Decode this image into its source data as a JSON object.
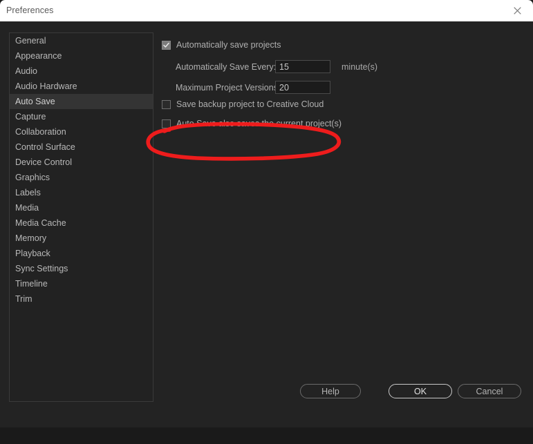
{
  "window": {
    "title": "Preferences",
    "close_icon": "close-icon"
  },
  "sidebar": {
    "items": [
      {
        "label": "General",
        "selected": false
      },
      {
        "label": "Appearance",
        "selected": false
      },
      {
        "label": "Audio",
        "selected": false
      },
      {
        "label": "Audio Hardware",
        "selected": false
      },
      {
        "label": "Auto Save",
        "selected": true
      },
      {
        "label": "Capture",
        "selected": false
      },
      {
        "label": "Collaboration",
        "selected": false
      },
      {
        "label": "Control Surface",
        "selected": false
      },
      {
        "label": "Device Control",
        "selected": false
      },
      {
        "label": "Graphics",
        "selected": false
      },
      {
        "label": "Labels",
        "selected": false
      },
      {
        "label": "Media",
        "selected": false
      },
      {
        "label": "Media Cache",
        "selected": false
      },
      {
        "label": "Memory",
        "selected": false
      },
      {
        "label": "Playback",
        "selected": false
      },
      {
        "label": "Sync Settings",
        "selected": false
      },
      {
        "label": "Timeline",
        "selected": false
      },
      {
        "label": "Trim",
        "selected": false
      }
    ]
  },
  "main": {
    "auto_save_checkbox": {
      "label": "Automatically save projects",
      "checked": true
    },
    "save_every": {
      "label": "Automatically Save Every:",
      "value": "15",
      "unit": "minute(s)"
    },
    "max_versions": {
      "label": "Maximum Project Versions:",
      "value": "20"
    },
    "backup_creative_cloud": {
      "label": "Save backup project to Creative Cloud",
      "checked": false
    },
    "save_current_projects": {
      "label": "Auto Save also saves the current project(s)",
      "checked": false
    }
  },
  "annotation": {
    "shape": "ellipse-highlight",
    "color": "#ee1c1c"
  },
  "footer": {
    "help_label": "Help",
    "ok_label": "OK",
    "cancel_label": "Cancel"
  }
}
